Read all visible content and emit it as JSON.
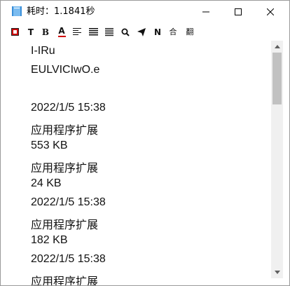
{
  "window": {
    "title": "耗时：1.1841秒"
  },
  "toolbar": {
    "items": [
      {
        "icon": "stop-square-icon",
        "label": ""
      },
      {
        "icon": "text-icon",
        "label": "T"
      },
      {
        "icon": "bold-icon",
        "label": "B"
      },
      {
        "icon": "font-color-icon",
        "label": "A"
      },
      {
        "icon": "align-left-icon",
        "label": ""
      },
      {
        "icon": "align-center-icon",
        "label": ""
      },
      {
        "icon": "justify-icon",
        "label": ""
      },
      {
        "icon": "search-icon",
        "label": ""
      },
      {
        "icon": "send-icon",
        "label": ""
      },
      {
        "icon": "n-icon",
        "label": "N"
      },
      {
        "icon": "merge-icon",
        "label": "合"
      },
      {
        "icon": "translate-icon",
        "label": "翻"
      }
    ]
  },
  "content": {
    "lines": [
      "I-IRu",
      "EULVICIwO.e",
      "",
      "2022/1/5 15:38",
      "应用程序扩展",
      "553 KB",
      "应用程序扩展",
      "24 KB",
      "2022/1/5 15:38",
      "应用程序扩展",
      "182 KB",
      "2022/1/5 15:38",
      "应用程序扩展"
    ]
  },
  "colors": {
    "accent_icon": "#3b8fd9",
    "stop_red": "#cc0000",
    "font_color_red": "#d00000"
  }
}
